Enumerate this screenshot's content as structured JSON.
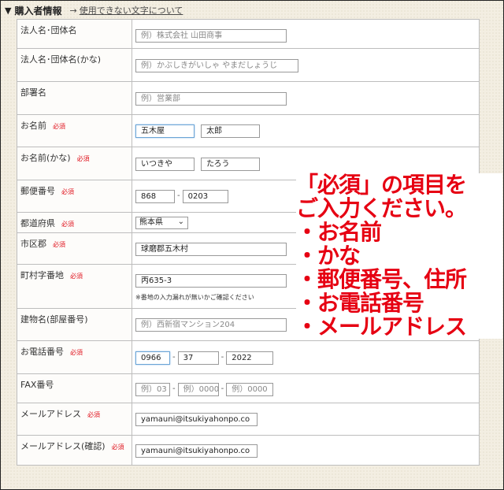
{
  "header": {
    "title": "購入者情報",
    "link_arrow": "→",
    "link_text": "使用できない文字について"
  },
  "required_label": "必須",
  "rows": {
    "corp": {
      "label": "法人名･団体名",
      "placeholder": "例）株式会社 山田商事"
    },
    "corp_kana": {
      "label": "法人名･団体名(かな)",
      "placeholder": "例）かぶしきがいしゃ やまだしょうじ"
    },
    "dept": {
      "label": "部署名",
      "placeholder": "例）営業部"
    },
    "name": {
      "label": "お名前",
      "last": "五木屋",
      "first": "太郎"
    },
    "name_kana": {
      "label": "お名前(かな)",
      "last": "いつきや",
      "first": "たろう"
    },
    "zip": {
      "label": "郵便番号",
      "part1": "868",
      "part2": "0203"
    },
    "pref": {
      "label": "都道府県",
      "value": "熊本県"
    },
    "city": {
      "label": "市区郡",
      "value": "球磨郡五木村"
    },
    "town": {
      "label": "町村字番地",
      "value": "丙635-3",
      "note": "※番地の入力漏れが無いかご確認ください"
    },
    "building": {
      "label": "建物名(部屋番号)",
      "placeholder": "例）西新宿マンション204"
    },
    "tel": {
      "label": "お電話番号",
      "part1": "0966",
      "part2": "37",
      "part3": "2022"
    },
    "fax": {
      "label": "FAX番号",
      "ph1": "例）03",
      "ph2": "例）0000",
      "ph3": "例）0000"
    },
    "email": {
      "label": "メールアドレス",
      "value": "yamauni@itsukiyahonpo.co"
    },
    "email_confirm": {
      "label": "メールアドレス(確認)",
      "value": "yamauni@itsukiyahonpo.co"
    }
  },
  "annotation": {
    "line1": "「必須」の項目を",
    "line2": "ご入力ください。",
    "line3": "・お名前",
    "line4": "・かな",
    "line5": "・郵便番号、住所",
    "line6": "・お電話番号",
    "line7": "・メールアドレス"
  },
  "colors": {
    "required": "#e0141e",
    "annotation": "#e60012",
    "focus_border": "#6ba4d6"
  }
}
